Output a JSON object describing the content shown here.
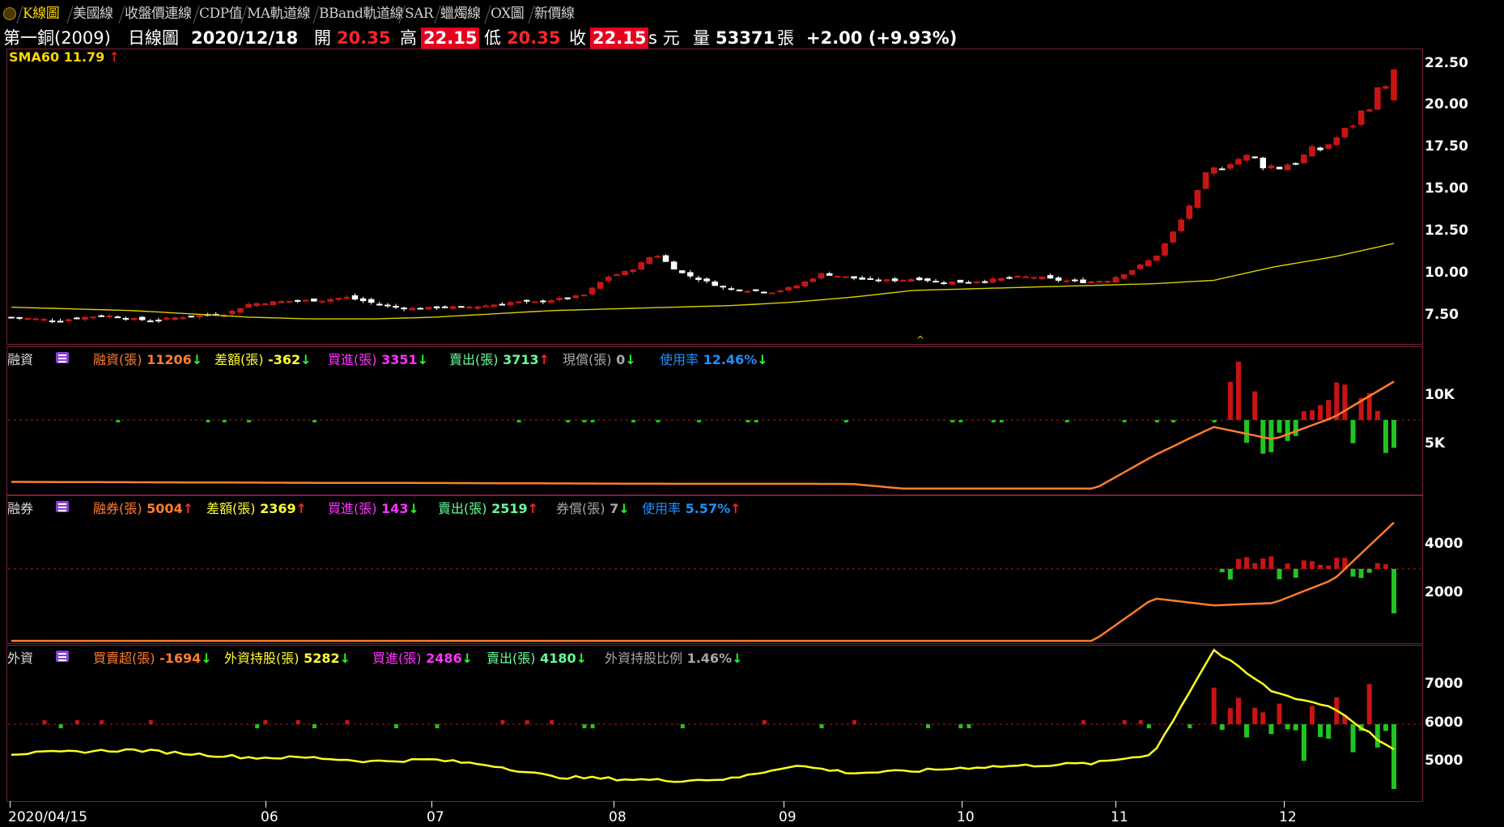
{
  "tabs": [
    "K線圖",
    "美國線",
    "收盤價連線",
    "CDP值",
    "MA軌道線",
    "BBand軌道線",
    "SAR",
    "蠟燭線",
    "OX圖",
    "新價線"
  ],
  "quote": {
    "stock": "第一銅(2009)",
    "chart_type": "日線圖",
    "date": "2020/12/18",
    "open_label": "開",
    "open": "20.35",
    "high_label": "高",
    "high": "22.15",
    "low_label": "低",
    "low": "20.35",
    "close_label": "收",
    "close": "22.15",
    "unit": "s 元",
    "volume_label": "量",
    "volume": "53371",
    "volume_unit": "張",
    "change": "+2.00 (+9.93%)"
  },
  "price_panel": {
    "indicator": "SMA60 11.79",
    "indicator_arrow": "↑",
    "y_ticks": [
      "22.50",
      "20.00",
      "17.50",
      "15.00",
      "12.50",
      "10.00",
      "7.50"
    ]
  },
  "margin_panel": {
    "title": "融資",
    "items": [
      {
        "label": "融資(張)",
        "value": "11206",
        "arrow": "↓",
        "color": "#ff7d2e",
        "arrowColor": "#22ff22"
      },
      {
        "label": "差額(張)",
        "value": "-362",
        "arrow": "↓",
        "color": "#ffff33",
        "arrowColor": "#22ff22"
      },
      {
        "label": "買進(張)",
        "value": "3351",
        "arrow": "↓",
        "color": "#ff33ff",
        "arrowColor": "#22ff22"
      },
      {
        "label": "賣出(張)",
        "value": "3713",
        "arrow": "↑",
        "color": "#66ff99",
        "arrowColor": "#ff2222"
      },
      {
        "label": "現償(張)",
        "value": "0",
        "arrow": "↓",
        "color": "#a8a8a8",
        "arrowColor": "#22ff22"
      },
      {
        "label": "使用率",
        "value": "12.46%",
        "arrow": "↓",
        "color": "#1e90ff",
        "arrowColor": "#22ff22"
      }
    ],
    "y_ticks": [
      "10K",
      "5K"
    ]
  },
  "short_panel": {
    "title": "融券",
    "items": [
      {
        "label": "融券(張)",
        "value": "5004",
        "arrow": "↑",
        "color": "#ff7d2e",
        "arrowColor": "#ff2222"
      },
      {
        "label": "差額(張)",
        "value": "2369",
        "arrow": "↑",
        "color": "#ffff33",
        "arrowColor": "#ff2222"
      },
      {
        "label": "買進(張)",
        "value": "143",
        "arrow": "↓",
        "color": "#ff33ff",
        "arrowColor": "#22ff22"
      },
      {
        "label": "賣出(張)",
        "value": "2519",
        "arrow": "↑",
        "color": "#66ff99",
        "arrowColor": "#ff2222"
      },
      {
        "label": "券償(張)",
        "value": "7",
        "arrow": "↓",
        "color": "#a8a8a8",
        "arrowColor": "#22ff22"
      },
      {
        "label": "使用率",
        "value": "5.57%",
        "arrow": "↑",
        "color": "#1e90ff",
        "arrowColor": "#ff2222"
      }
    ],
    "y_ticks": [
      "4000",
      "2000"
    ]
  },
  "foreign_panel": {
    "title": "外資",
    "items": [
      {
        "label": "買賣超(張)",
        "value": "-1694",
        "arrow": "↓",
        "color": "#ff7d2e",
        "arrowColor": "#22ff22"
      },
      {
        "label": "外資持股(張)",
        "value": "5282",
        "arrow": "↓",
        "color": "#ffff33",
        "arrowColor": "#22ff22"
      },
      {
        "label": "買進(張)",
        "value": "2486",
        "arrow": "↓",
        "color": "#ff33ff",
        "arrowColor": "#22ff22"
      },
      {
        "label": "賣出(張)",
        "value": "4180",
        "arrow": "↓",
        "color": "#66ff99",
        "arrowColor": "#22ff22"
      },
      {
        "label": "外資持股比例",
        "value": "1.46%",
        "arrow": "↓",
        "color": "#a8a8a8",
        "arrowColor": "#22ff22"
      }
    ],
    "y_ticks": [
      "7000",
      "6000",
      "5000"
    ]
  },
  "x_axis": [
    "2020/04/15",
    "06",
    "07",
    "08",
    "09",
    "10",
    "11",
    "12"
  ],
  "colors": {
    "up": "#e01818",
    "down": "#ffffff",
    "sma": "#d8d000",
    "margin_line": "#ff7d2e",
    "foreign_line": "#ffff22",
    "panel_border": "#7c1e3a",
    "zero_line": "#b02020"
  },
  "chart_data": [
    {
      "type": "line",
      "name": "price",
      "series": [
        {
          "name": "SMA60",
          "values": [
            8.0,
            7.9,
            7.8,
            7.6,
            7.4,
            7.3,
            7.3,
            7.4,
            7.6,
            7.8,
            7.9,
            8.0,
            8.1,
            8.3,
            8.6,
            9.0,
            9.1,
            9.2,
            9.3,
            9.4,
            9.6,
            10.4,
            11.0,
            11.8
          ]
        }
      ],
      "y_ticks": [
        7.5,
        10.0,
        12.5,
        15.0,
        17.5,
        20.0,
        22.5
      ]
    },
    {
      "type": "line",
      "name": "margin",
      "series": [
        {
          "name": "融資(張)",
          "values": [
            800,
            780,
            760,
            740,
            720,
            700,
            700,
            680,
            660,
            640,
            620,
            600,
            600,
            600,
            580,
            0,
            0,
            0,
            0,
            3500,
            6500,
            5200,
            7500,
            11206
          ]
        }
      ]
    },
    {
      "type": "line",
      "name": "short",
      "series": [
        {
          "name": "融券(張)",
          "values": [
            0,
            0,
            0,
            0,
            0,
            0,
            0,
            0,
            0,
            0,
            0,
            0,
            0,
            0,
            0,
            0,
            0,
            0,
            0,
            1800,
            1500,
            1600,
            2600,
            5004
          ]
        }
      ]
    },
    {
      "type": "line",
      "name": "foreign",
      "series": [
        {
          "name": "外資持股(張)",
          "values": [
            5200,
            5250,
            5300,
            5200,
            5100,
            5100,
            5000,
            5050,
            4900,
            4600,
            4550,
            4500,
            4550,
            4900,
            4700,
            4750,
            4850,
            4900,
            4950,
            5200,
            7900,
            6800,
            6400,
            5282
          ]
        }
      ]
    }
  ]
}
